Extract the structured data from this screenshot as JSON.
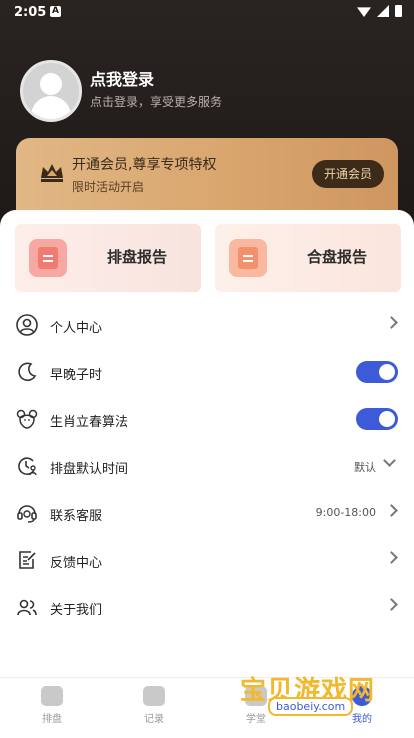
{
  "statusbar": {
    "time": "2:05",
    "app_badge": "A"
  },
  "profile": {
    "title": "点我登录",
    "subtitle": "点击登录，享受更多服务"
  },
  "vip": {
    "title": "开通会员,尊享专项特权",
    "subtitle": "限时活动开启",
    "button": "开通会员"
  },
  "reports": [
    {
      "label": "排盘报告",
      "icon": "document-icon"
    },
    {
      "label": "合盘报告",
      "icon": "document-list-icon"
    }
  ],
  "menu": [
    {
      "label": "个人中心",
      "icon": "user-circle-icon",
      "control": "chevron"
    },
    {
      "label": "早晚子时",
      "icon": "moon-icon",
      "control": "toggle",
      "value": true
    },
    {
      "label": "生肖立春算法",
      "icon": "mouse-zodiac-icon",
      "control": "toggle",
      "value": true
    },
    {
      "label": "排盘默认时间",
      "icon": "clock-person-icon",
      "control": "dropdown",
      "value": "默认"
    },
    {
      "label": "联系客服",
      "icon": "headset-icon",
      "control": "chevron",
      "value": "9:00-18:00"
    },
    {
      "label": "反馈中心",
      "icon": "edit-note-icon",
      "control": "chevron"
    },
    {
      "label": "关于我们",
      "icon": "users-icon",
      "control": "chevron"
    }
  ],
  "tabs": [
    {
      "label": "排盘",
      "icon": "chart-icon",
      "active": false
    },
    {
      "label": "记录",
      "icon": "calendar-icon",
      "active": false
    },
    {
      "label": "学堂",
      "icon": "book-icon",
      "active": false
    },
    {
      "label": "我的",
      "icon": "person-icon",
      "active": true
    }
  ],
  "watermark": {
    "text": "宝贝游戏网",
    "url": "baobeiy.com"
  },
  "colors": {
    "accent": "#3d5bd9",
    "vip_gold": "#d9a66e",
    "dark_bg": "#1f1a17"
  }
}
